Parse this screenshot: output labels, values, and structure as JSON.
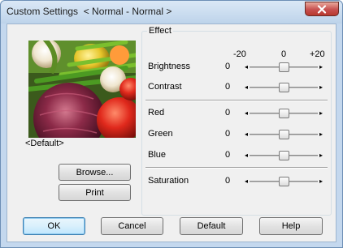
{
  "window": {
    "title": "Custom Settings  < Normal - Normal >",
    "close_label": "×"
  },
  "preview": {
    "default_label": "<Default>",
    "browse_button": "Browse...",
    "print_button": "Print"
  },
  "effect": {
    "group_title": "Effect",
    "scale": {
      "min_label": "-20",
      "mid_label": "0",
      "max_label": "+20"
    },
    "sliders": [
      {
        "id": "brightness",
        "label": "Brightness",
        "value": "0",
        "level": 0
      },
      {
        "id": "contrast",
        "label": "Contrast",
        "value": "0",
        "level": 0
      },
      {
        "id": "red",
        "label": "Red",
        "value": "0",
        "level": 0
      },
      {
        "id": "green",
        "label": "Green",
        "value": "0",
        "level": 0
      },
      {
        "id": "blue",
        "label": "Blue",
        "value": "0",
        "level": 0
      },
      {
        "id": "saturation",
        "label": "Saturation",
        "value": "0",
        "level": 0
      }
    ],
    "range": [
      -20,
      20
    ]
  },
  "footer": {
    "ok": "OK",
    "cancel": "Cancel",
    "default": "Default",
    "help": "Help"
  }
}
